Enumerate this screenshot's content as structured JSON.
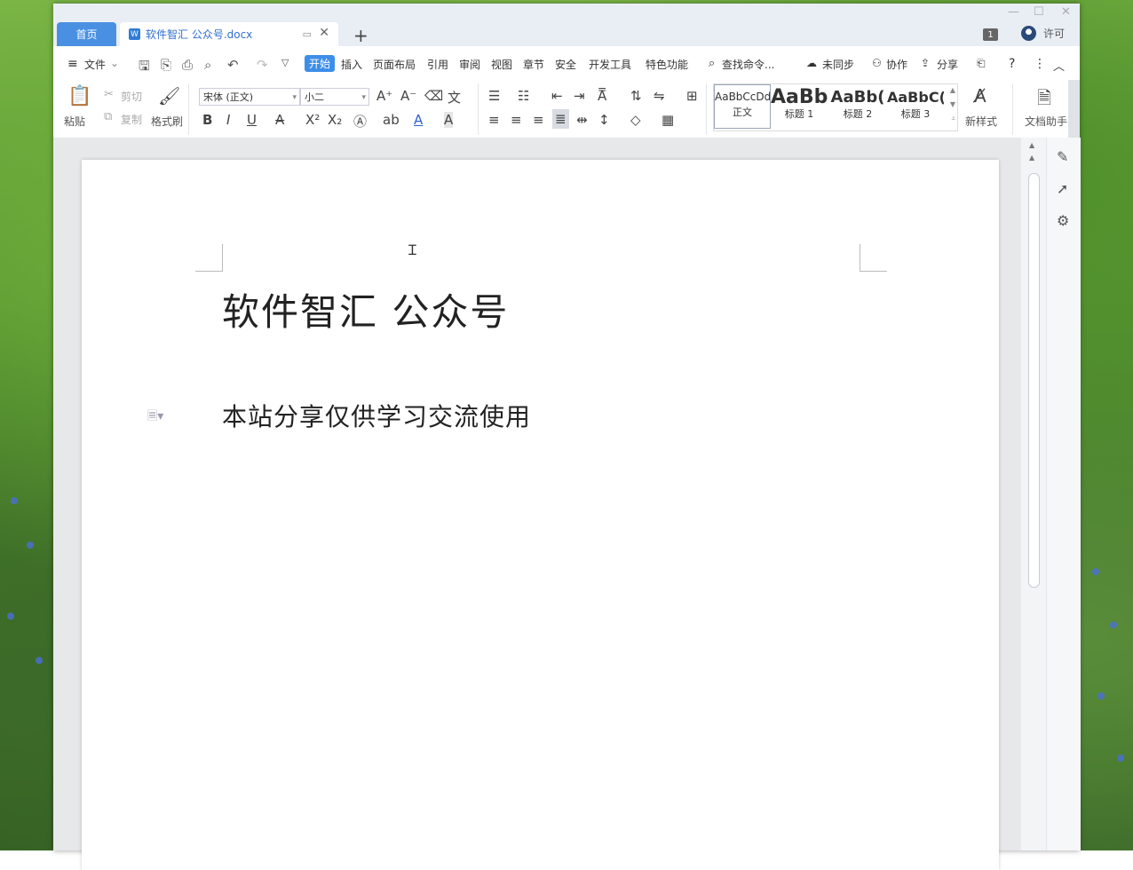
{
  "tabs": {
    "home": "首页",
    "document": "软件智汇 公众号.docx",
    "new_tab": "+"
  },
  "titlebar": {
    "badge": "1",
    "user": "许可"
  },
  "menu": {
    "file": "文件",
    "tabs": [
      "开始",
      "插入",
      "页面布局",
      "引用",
      "审阅",
      "视图",
      "章节",
      "安全",
      "开发工具",
      "特色功能"
    ],
    "active_tab": "开始",
    "search": "查找命令...",
    "sync": "未同步",
    "collab": "协作",
    "share": "分享"
  },
  "ribbon": {
    "paste": "粘贴",
    "cut": "剪切",
    "copy": "复制",
    "format_painter": "格式刷",
    "font_name": "宋体 (正文)",
    "font_size": "小二",
    "styles": [
      {
        "preview": "AaBbCcDd",
        "label": "正文"
      },
      {
        "preview": "AaBb",
        "label": "标题 1"
      },
      {
        "preview": "AaBb(",
        "label": "标题 2"
      },
      {
        "preview": "AaBbC(",
        "label": "标题 3"
      }
    ],
    "new_style": "新样式",
    "doc_assistant": "文档助手"
  },
  "document": {
    "title": "软件智汇  公众号",
    "body": "本站分享仅供学习交流使用"
  },
  "colors": {
    "accent": "#3d8ee8",
    "home_tab": "#4a90e2"
  }
}
